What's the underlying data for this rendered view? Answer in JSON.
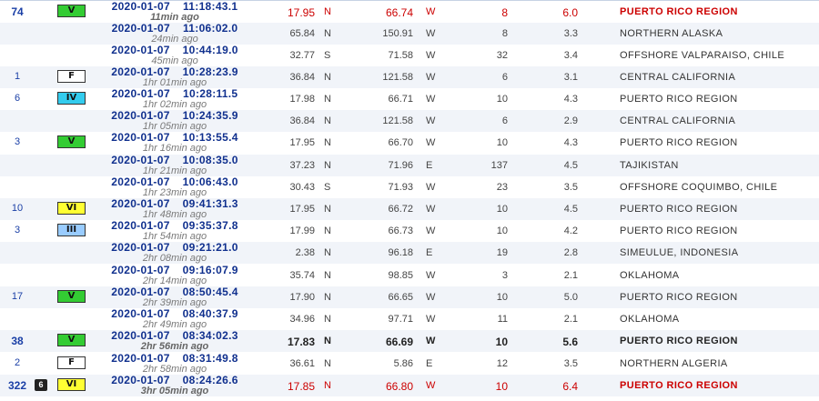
{
  "colors": {
    "link": "#1a3fa6",
    "datetime": "#10308e",
    "major_quake": "#cc0000",
    "inten_V": "#33cc33",
    "inten_IV": "#33ccee",
    "inten_VI": "#ffff33",
    "inten_III": "#99ccff",
    "inten_F": "#ffffff"
  },
  "rows": [
    {
      "count": "74",
      "photo": "",
      "inten": "V",
      "inten_color": "#33cc33",
      "date": "2020-01-07",
      "time": "11:18:43.1",
      "ago": "11min ago",
      "lat": "17.95",
      "ns": "N",
      "lon": "66.74",
      "ew": "W",
      "depth": "8",
      "mag": "6.0",
      "region": "PUERTO RICO REGION",
      "style": "red"
    },
    {
      "count": "",
      "photo": "",
      "inten": "",
      "inten_color": "",
      "date": "2020-01-07",
      "time": "11:06:02.0",
      "ago": "24min ago",
      "lat": "65.84",
      "ns": "N",
      "lon": "150.91",
      "ew": "W",
      "depth": "8",
      "mag": "3.3",
      "region": "NORTHERN ALASKA",
      "style": "alt"
    },
    {
      "count": "",
      "photo": "",
      "inten": "",
      "inten_color": "",
      "date": "2020-01-07",
      "time": "10:44:19.0",
      "ago": "45min ago",
      "lat": "32.77",
      "ns": "S",
      "lon": "71.58",
      "ew": "W",
      "depth": "32",
      "mag": "3.4",
      "region": "OFFSHORE VALPARAISO, CHILE",
      "style": ""
    },
    {
      "count": "1",
      "photo": "",
      "inten": "F",
      "inten_color": "#ffffff",
      "date": "2020-01-07",
      "time": "10:28:23.9",
      "ago": "1hr 01min ago",
      "lat": "36.84",
      "ns": "N",
      "lon": "121.58",
      "ew": "W",
      "depth": "6",
      "mag": "3.1",
      "region": "CENTRAL CALIFORNIA",
      "style": "alt"
    },
    {
      "count": "6",
      "photo": "",
      "inten": "IV",
      "inten_color": "#33ccee",
      "date": "2020-01-07",
      "time": "10:28:11.5",
      "ago": "1hr 02min ago",
      "lat": "17.98",
      "ns": "N",
      "lon": "66.71",
      "ew": "W",
      "depth": "10",
      "mag": "4.3",
      "region": "PUERTO RICO REGION",
      "style": ""
    },
    {
      "count": "",
      "photo": "",
      "inten": "",
      "inten_color": "",
      "date": "2020-01-07",
      "time": "10:24:35.9",
      "ago": "1hr 05min ago",
      "lat": "36.84",
      "ns": "N",
      "lon": "121.58",
      "ew": "W",
      "depth": "6",
      "mag": "2.9",
      "region": "CENTRAL CALIFORNIA",
      "style": "alt"
    },
    {
      "count": "3",
      "photo": "",
      "inten": "V",
      "inten_color": "#33cc33",
      "date": "2020-01-07",
      "time": "10:13:55.4",
      "ago": "1hr 16min ago",
      "lat": "17.95",
      "ns": "N",
      "lon": "66.70",
      "ew": "W",
      "depth": "10",
      "mag": "4.3",
      "region": "PUERTO RICO REGION",
      "style": ""
    },
    {
      "count": "",
      "photo": "",
      "inten": "",
      "inten_color": "",
      "date": "2020-01-07",
      "time": "10:08:35.0",
      "ago": "1hr 21min ago",
      "lat": "37.23",
      "ns": "N",
      "lon": "71.96",
      "ew": "E",
      "depth": "137",
      "mag": "4.5",
      "region": "TAJIKISTAN",
      "style": "alt"
    },
    {
      "count": "",
      "photo": "",
      "inten": "",
      "inten_color": "",
      "date": "2020-01-07",
      "time": "10:06:43.0",
      "ago": "1hr 23min ago",
      "lat": "30.43",
      "ns": "S",
      "lon": "71.93",
      "ew": "W",
      "depth": "23",
      "mag": "3.5",
      "region": "OFFSHORE COQUIMBO, CHILE",
      "style": ""
    },
    {
      "count": "10",
      "photo": "",
      "inten": "VI",
      "inten_color": "#ffff33",
      "date": "2020-01-07",
      "time": "09:41:31.3",
      "ago": "1hr 48min ago",
      "lat": "17.95",
      "ns": "N",
      "lon": "66.72",
      "ew": "W",
      "depth": "10",
      "mag": "4.5",
      "region": "PUERTO RICO REGION",
      "style": "alt"
    },
    {
      "count": "3",
      "photo": "",
      "inten": "III",
      "inten_color": "#99ccff",
      "date": "2020-01-07",
      "time": "09:35:37.8",
      "ago": "1hr 54min ago",
      "lat": "17.99",
      "ns": "N",
      "lon": "66.73",
      "ew": "W",
      "depth": "10",
      "mag": "4.2",
      "region": "PUERTO RICO REGION",
      "style": ""
    },
    {
      "count": "",
      "photo": "",
      "inten": "",
      "inten_color": "",
      "date": "2020-01-07",
      "time": "09:21:21.0",
      "ago": "2hr 08min ago",
      "lat": "2.38",
      "ns": "N",
      "lon": "96.18",
      "ew": "E",
      "depth": "19",
      "mag": "2.8",
      "region": "SIMEULUE, INDONESIA",
      "style": "alt"
    },
    {
      "count": "",
      "photo": "",
      "inten": "",
      "inten_color": "",
      "date": "2020-01-07",
      "time": "09:16:07.9",
      "ago": "2hr 14min ago",
      "lat": "35.74",
      "ns": "N",
      "lon": "98.85",
      "ew": "W",
      "depth": "3",
      "mag": "2.1",
      "region": "OKLAHOMA",
      "style": ""
    },
    {
      "count": "17",
      "photo": "",
      "inten": "V",
      "inten_color": "#33cc33",
      "date": "2020-01-07",
      "time": "08:50:45.4",
      "ago": "2hr 39min ago",
      "lat": "17.90",
      "ns": "N",
      "lon": "66.65",
      "ew": "W",
      "depth": "10",
      "mag": "5.0",
      "region": "PUERTO RICO REGION",
      "style": "alt"
    },
    {
      "count": "",
      "photo": "",
      "inten": "",
      "inten_color": "",
      "date": "2020-01-07",
      "time": "08:40:37.9",
      "ago": "2hr 49min ago",
      "lat": "34.96",
      "ns": "N",
      "lon": "97.71",
      "ew": "W",
      "depth": "11",
      "mag": "2.1",
      "region": "OKLAHOMA",
      "style": ""
    },
    {
      "count": "38",
      "photo": "",
      "inten": "V",
      "inten_color": "#33cc33",
      "date": "2020-01-07",
      "time": "08:34:02.3",
      "ago": "2hr 56min ago",
      "lat": "17.83",
      "ns": "N",
      "lon": "66.69",
      "ew": "W",
      "depth": "10",
      "mag": "5.6",
      "region": "PUERTO RICO REGION",
      "style": "alt bold"
    },
    {
      "count": "2",
      "photo": "",
      "inten": "F",
      "inten_color": "#ffffff",
      "date": "2020-01-07",
      "time": "08:31:49.8",
      "ago": "2hr 58min ago",
      "lat": "36.61",
      "ns": "N",
      "lon": "5.86",
      "ew": "E",
      "depth": "12",
      "mag": "3.5",
      "region": "NORTHERN ALGERIA",
      "style": ""
    },
    {
      "count": "322",
      "photo": "6",
      "inten": "VI",
      "inten_color": "#ffff33",
      "date": "2020-01-07",
      "time": "08:24:26.6",
      "ago": "3hr 05min ago",
      "lat": "17.85",
      "ns": "N",
      "lon": "66.80",
      "ew": "W",
      "depth": "10",
      "mag": "6.4",
      "region": "PUERTO RICO REGION",
      "style": "alt red"
    }
  ]
}
